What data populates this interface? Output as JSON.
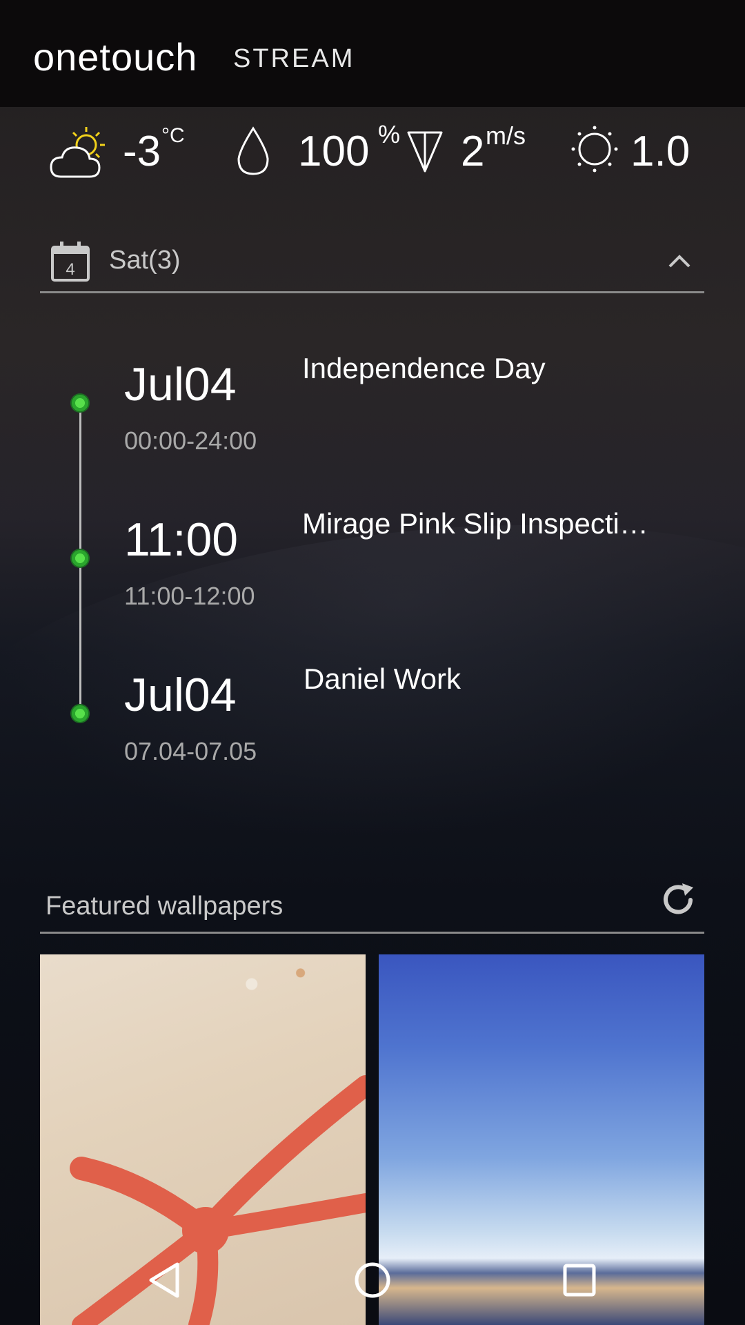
{
  "header": {
    "brand": "onetouch",
    "brand_sub": "STREAM"
  },
  "weather": {
    "temperature": "-3",
    "temperature_unit": "°C",
    "humidity": "100",
    "humidity_unit": "%",
    "wind": "2",
    "wind_unit": "m/s",
    "uv": "1.0",
    "icons": [
      "partly-cloudy-icon",
      "raindrop-icon",
      "wind-direction-icon",
      "sun-icon"
    ]
  },
  "calendar": {
    "day_badge": "4",
    "label": "Sat(3)",
    "events": [
      {
        "time": "Jul04",
        "range": "00:00-24:00",
        "title": "Independence Day"
      },
      {
        "time": "11:00",
        "range": "11:00-12:00",
        "title": "Mirage Pink Slip Inspecti…"
      },
      {
        "time": "Jul04",
        "range": "07.04-07.05",
        "title": "Daniel Work"
      }
    ]
  },
  "wallpapers": {
    "label": "Featured wallpapers"
  },
  "colors": {
    "accent_green": "#3fcf3a",
    "divider": "#8a8a8a",
    "sun_yellow": "#f2d21b"
  }
}
